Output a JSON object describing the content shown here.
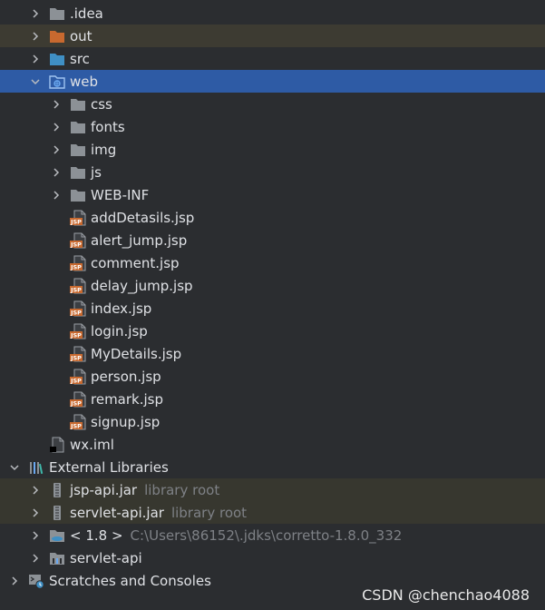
{
  "tree": [
    {
      "name": "idea-folder",
      "label": ".idea",
      "indent": 1,
      "arrow": "right",
      "icon": "folder-grey",
      "hl": ""
    },
    {
      "name": "out-folder",
      "label": "out",
      "indent": 1,
      "arrow": "right",
      "icon": "folder-orange",
      "hl": "excluded"
    },
    {
      "name": "src-folder",
      "label": "src",
      "indent": 1,
      "arrow": "right",
      "icon": "folder-blue",
      "hl": ""
    },
    {
      "name": "web-folder",
      "label": "web",
      "indent": 1,
      "arrow": "down",
      "icon": "folder-web",
      "hl": "selected"
    },
    {
      "name": "css-folder",
      "label": "css",
      "indent": 2,
      "arrow": "right",
      "icon": "folder-grey",
      "hl": ""
    },
    {
      "name": "fonts-folder",
      "label": "fonts",
      "indent": 2,
      "arrow": "right",
      "icon": "folder-grey",
      "hl": ""
    },
    {
      "name": "img-folder",
      "label": "img",
      "indent": 2,
      "arrow": "right",
      "icon": "folder-grey",
      "hl": ""
    },
    {
      "name": "js-folder",
      "label": "js",
      "indent": 2,
      "arrow": "right",
      "icon": "folder-grey",
      "hl": ""
    },
    {
      "name": "web-inf-folder",
      "label": "WEB-INF",
      "indent": 2,
      "arrow": "right",
      "icon": "folder-grey",
      "hl": ""
    },
    {
      "name": "file-adddetasils-jsp",
      "label": "addDetasils.jsp",
      "indent": 2,
      "arrow": "",
      "icon": "jsp",
      "hl": ""
    },
    {
      "name": "file-alert-jump-jsp",
      "label": "alert_jump.jsp",
      "indent": 2,
      "arrow": "",
      "icon": "jsp",
      "hl": ""
    },
    {
      "name": "file-comment-jsp",
      "label": "comment.jsp",
      "indent": 2,
      "arrow": "",
      "icon": "jsp",
      "hl": ""
    },
    {
      "name": "file-delay-jump-jsp",
      "label": "delay_jump.jsp",
      "indent": 2,
      "arrow": "",
      "icon": "jsp",
      "hl": ""
    },
    {
      "name": "file-index-jsp",
      "label": "index.jsp",
      "indent": 2,
      "arrow": "",
      "icon": "jsp",
      "hl": ""
    },
    {
      "name": "file-login-jsp",
      "label": "login.jsp",
      "indent": 2,
      "arrow": "",
      "icon": "jsp",
      "hl": ""
    },
    {
      "name": "file-mydetails-jsp",
      "label": "MyDetails.jsp",
      "indent": 2,
      "arrow": "",
      "icon": "jsp",
      "hl": ""
    },
    {
      "name": "file-person-jsp",
      "label": "person.jsp",
      "indent": 2,
      "arrow": "",
      "icon": "jsp",
      "hl": ""
    },
    {
      "name": "file-remark-jsp",
      "label": "remark.jsp",
      "indent": 2,
      "arrow": "",
      "icon": "jsp",
      "hl": ""
    },
    {
      "name": "file-signup-jsp",
      "label": "signup.jsp",
      "indent": 2,
      "arrow": "",
      "icon": "jsp",
      "hl": ""
    },
    {
      "name": "file-wx-iml",
      "label": "wx.iml",
      "indent": 1,
      "arrow": "",
      "icon": "iml",
      "hl": ""
    },
    {
      "name": "external-libraries",
      "label": "External Libraries",
      "indent": 0,
      "arrow": "down",
      "icon": "libraries",
      "hl": ""
    },
    {
      "name": "lib-jsp-api-jar",
      "label": "jsp-api.jar",
      "hint": "library root",
      "indent": 1,
      "arrow": "right",
      "icon": "jar",
      "hl": "lib"
    },
    {
      "name": "lib-servlet-api-jar",
      "label": "servlet-api.jar",
      "hint": "library root",
      "indent": 1,
      "arrow": "right",
      "icon": "jar",
      "hl": "lib"
    },
    {
      "name": "lib-jdk",
      "label": "< 1.8 >",
      "hint": "C:\\Users\\86152\\.jdks\\corretto-1.8.0_332",
      "indent": 1,
      "arrow": "right",
      "icon": "jdk",
      "hl": ""
    },
    {
      "name": "lib-servlet-api",
      "label": "servlet-api",
      "indent": 1,
      "arrow": "right",
      "icon": "lib",
      "hl": ""
    },
    {
      "name": "scratches-and-consoles",
      "label": "Scratches and Consoles",
      "indent": 0,
      "arrow": "right",
      "icon": "scratches",
      "hl": ""
    }
  ],
  "watermark": "CSDN @chenchao4088",
  "colors": {
    "background": "#2b2d30",
    "selected": "#2e5ba5",
    "excluded": "#3d3b32",
    "folder_grey": "#8c9196",
    "folder_orange": "#c8692f",
    "folder_blue": "#3f8fc4",
    "jsp_orange": "#c8692f"
  }
}
